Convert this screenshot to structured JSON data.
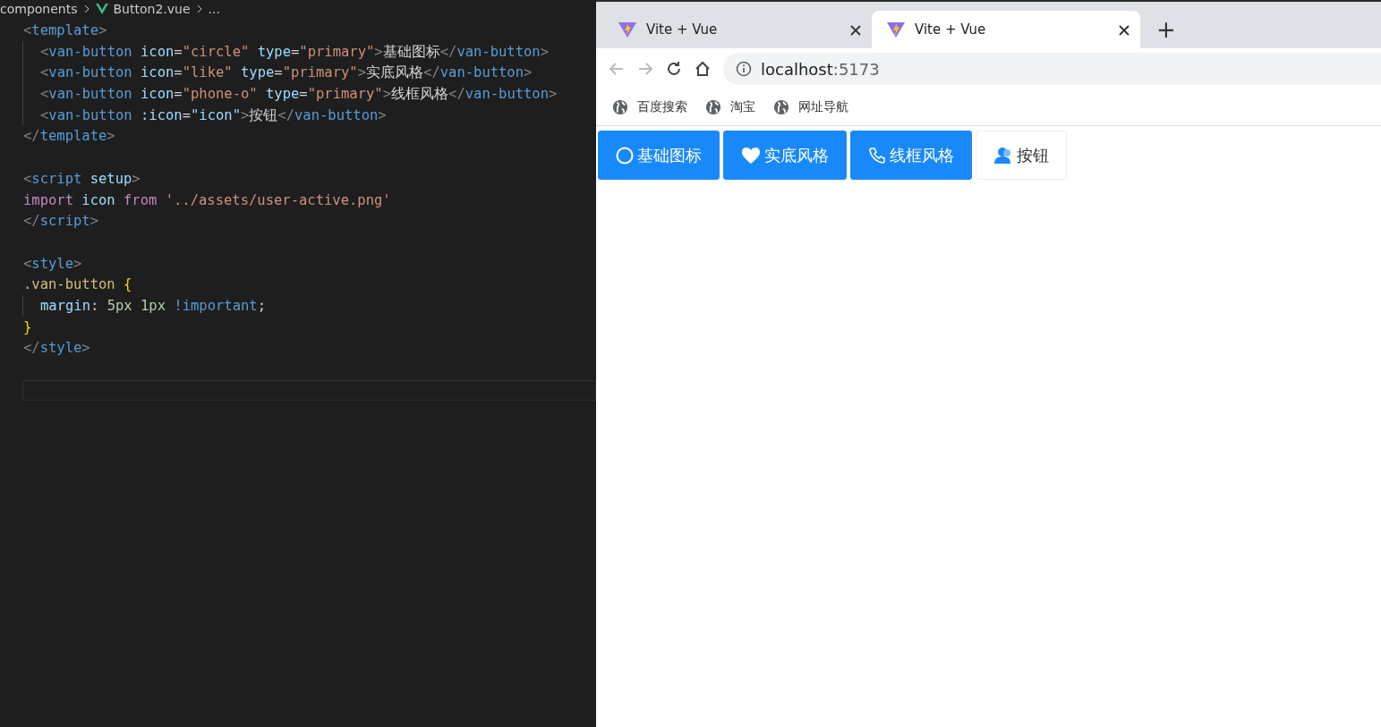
{
  "editor": {
    "breadcrumb": [
      "components",
      "Button2.vue",
      "..."
    ],
    "lines": [
      {
        "kind": "code",
        "tokens": [
          {
            "text": "<",
            "kind": "punct"
          },
          {
            "text": "template",
            "kind": "tag"
          },
          {
            "text": ">",
            "kind": "punct"
          }
        ],
        "children": [
          {
            "kind": "code",
            "tokens": [
              {
                "text": "<",
                "kind": "punct"
              },
              {
                "text": "van-button",
                "kind": "tag"
              },
              {
                "text": " icon",
                "kind": "attr"
              },
              {
                "text": "=",
                "kind": "plain"
              },
              {
                "text": "\"circle\"",
                "kind": "str"
              },
              {
                "text": " type",
                "kind": "attr"
              },
              {
                "text": "=",
                "kind": "plain"
              },
              {
                "text": "\"primary\"",
                "kind": "str"
              },
              {
                "text": ">",
                "kind": "punct"
              },
              {
                "text": "基础图标",
                "kind": "plain"
              },
              {
                "text": "</",
                "kind": "punct"
              },
              {
                "text": "van-button",
                "kind": "tag"
              },
              {
                "text": ">",
                "kind": "punct"
              }
            ]
          },
          {
            "kind": "code",
            "tokens": [
              {
                "text": "<",
                "kind": "punct"
              },
              {
                "text": "van-button",
                "kind": "tag"
              },
              {
                "text": " icon",
                "kind": "attr"
              },
              {
                "text": "=",
                "kind": "plain"
              },
              {
                "text": "\"like\"",
                "kind": "str"
              },
              {
                "text": " type",
                "kind": "attr"
              },
              {
                "text": "=",
                "kind": "plain"
              },
              {
                "text": "\"primary\"",
                "kind": "str"
              },
              {
                "text": ">",
                "kind": "punct"
              },
              {
                "text": "实底风格",
                "kind": "plain"
              },
              {
                "text": "</",
                "kind": "punct"
              },
              {
                "text": "van-button",
                "kind": "tag"
              },
              {
                "text": ">",
                "kind": "punct"
              }
            ]
          },
          {
            "kind": "code",
            "tokens": [
              {
                "text": "<",
                "kind": "punct"
              },
              {
                "text": "van-button",
                "kind": "tag"
              },
              {
                "text": " icon",
                "kind": "attr"
              },
              {
                "text": "=",
                "kind": "plain"
              },
              {
                "text": "\"phone-o\"",
                "kind": "str"
              },
              {
                "text": " type",
                "kind": "attr"
              },
              {
                "text": "=",
                "kind": "plain"
              },
              {
                "text": "\"primary\"",
                "kind": "str"
              },
              {
                "text": ">",
                "kind": "punct"
              },
              {
                "text": "线框风格",
                "kind": "plain"
              },
              {
                "text": "</",
                "kind": "punct"
              },
              {
                "text": "van-button",
                "kind": "tag"
              },
              {
                "text": ">",
                "kind": "punct"
              }
            ]
          },
          {
            "kind": "code",
            "tokens": [
              {
                "text": "<",
                "kind": "punct"
              },
              {
                "text": "van-button",
                "kind": "tag"
              },
              {
                "text": " :icon",
                "kind": "attr"
              },
              {
                "text": "=",
                "kind": "plain"
              },
              {
                "text": "\"icon\"",
                "kind": "attr"
              },
              {
                "text": ">",
                "kind": "punct"
              },
              {
                "text": "按钮",
                "kind": "plain"
              },
              {
                "text": "</",
                "kind": "punct"
              },
              {
                "text": "van-button",
                "kind": "tag"
              },
              {
                "text": ">",
                "kind": "punct"
              }
            ]
          }
        ]
      },
      {
        "kind": "code",
        "tokens": [
          {
            "text": "</",
            "kind": "punct"
          },
          {
            "text": "template",
            "kind": "tag"
          },
          {
            "text": ">",
            "kind": "punct"
          }
        ]
      },
      {
        "kind": "blank"
      },
      {
        "kind": "code",
        "tokens": [
          {
            "text": "<",
            "kind": "punct"
          },
          {
            "text": "script",
            "kind": "tag"
          },
          {
            "text": " setup",
            "kind": "attr"
          },
          {
            "text": ">",
            "kind": "punct"
          }
        ]
      },
      {
        "kind": "code",
        "tokens": [
          {
            "text": "import",
            "kind": "keyword"
          },
          {
            "text": " icon",
            "kind": "attr"
          },
          {
            "text": " from",
            "kind": "keyword"
          },
          {
            "text": " '../assets/user-active.png'",
            "kind": "str"
          }
        ]
      },
      {
        "kind": "code",
        "tokens": [
          {
            "text": "</",
            "kind": "punct"
          },
          {
            "text": "script",
            "kind": "tag"
          },
          {
            "text": ">",
            "kind": "punct"
          }
        ]
      },
      {
        "kind": "blank"
      },
      {
        "kind": "code",
        "tokens": [
          {
            "text": "<",
            "kind": "punct"
          },
          {
            "text": "style",
            "kind": "tag"
          },
          {
            "text": ">",
            "kind": "punct"
          }
        ]
      },
      {
        "kind": "code",
        "tokens": [
          {
            "text": ".van-button",
            "kind": "selector"
          },
          {
            "text": " {",
            "kind": "brace"
          }
        ],
        "children": [
          {
            "kind": "code",
            "tokens": [
              {
                "text": "margin",
                "kind": "attr"
              },
              {
                "text": ":",
                "kind": "plain"
              },
              {
                "text": " 5px 1px",
                "kind": "num"
              },
              {
                "text": " !important",
                "kind": "tag"
              },
              {
                "text": ";",
                "kind": "plain"
              }
            ]
          }
        ]
      },
      {
        "kind": "code",
        "tokens": [
          {
            "text": "}",
            "kind": "brace"
          }
        ]
      },
      {
        "kind": "code",
        "tokens": [
          {
            "text": "</",
            "kind": "punct"
          },
          {
            "text": "style",
            "kind": "tag"
          },
          {
            "text": ">",
            "kind": "punct"
          }
        ]
      },
      {
        "kind": "blank"
      },
      {
        "kind": "blank",
        "current": true
      }
    ]
  },
  "browser": {
    "tabs": [
      {
        "title": "Vite + Vue",
        "selected": false
      },
      {
        "title": "Vite + Vue",
        "selected": true
      }
    ],
    "new_tab": "+",
    "nav": {
      "back_disabled": true,
      "forward_disabled": true
    },
    "address": {
      "host": "localhost",
      "port": ":5173"
    },
    "bookmarks": [
      "百度搜索",
      "淘宝",
      "网址导航"
    ],
    "buttons": [
      {
        "label": "基础图标",
        "kind": "circle",
        "primary": true
      },
      {
        "label": "实底风格",
        "kind": "heart",
        "primary": true
      },
      {
        "label": "线框风格",
        "kind": "phone",
        "primary": true
      },
      {
        "label": "按钮",
        "kind": "user",
        "primary": false
      }
    ]
  }
}
